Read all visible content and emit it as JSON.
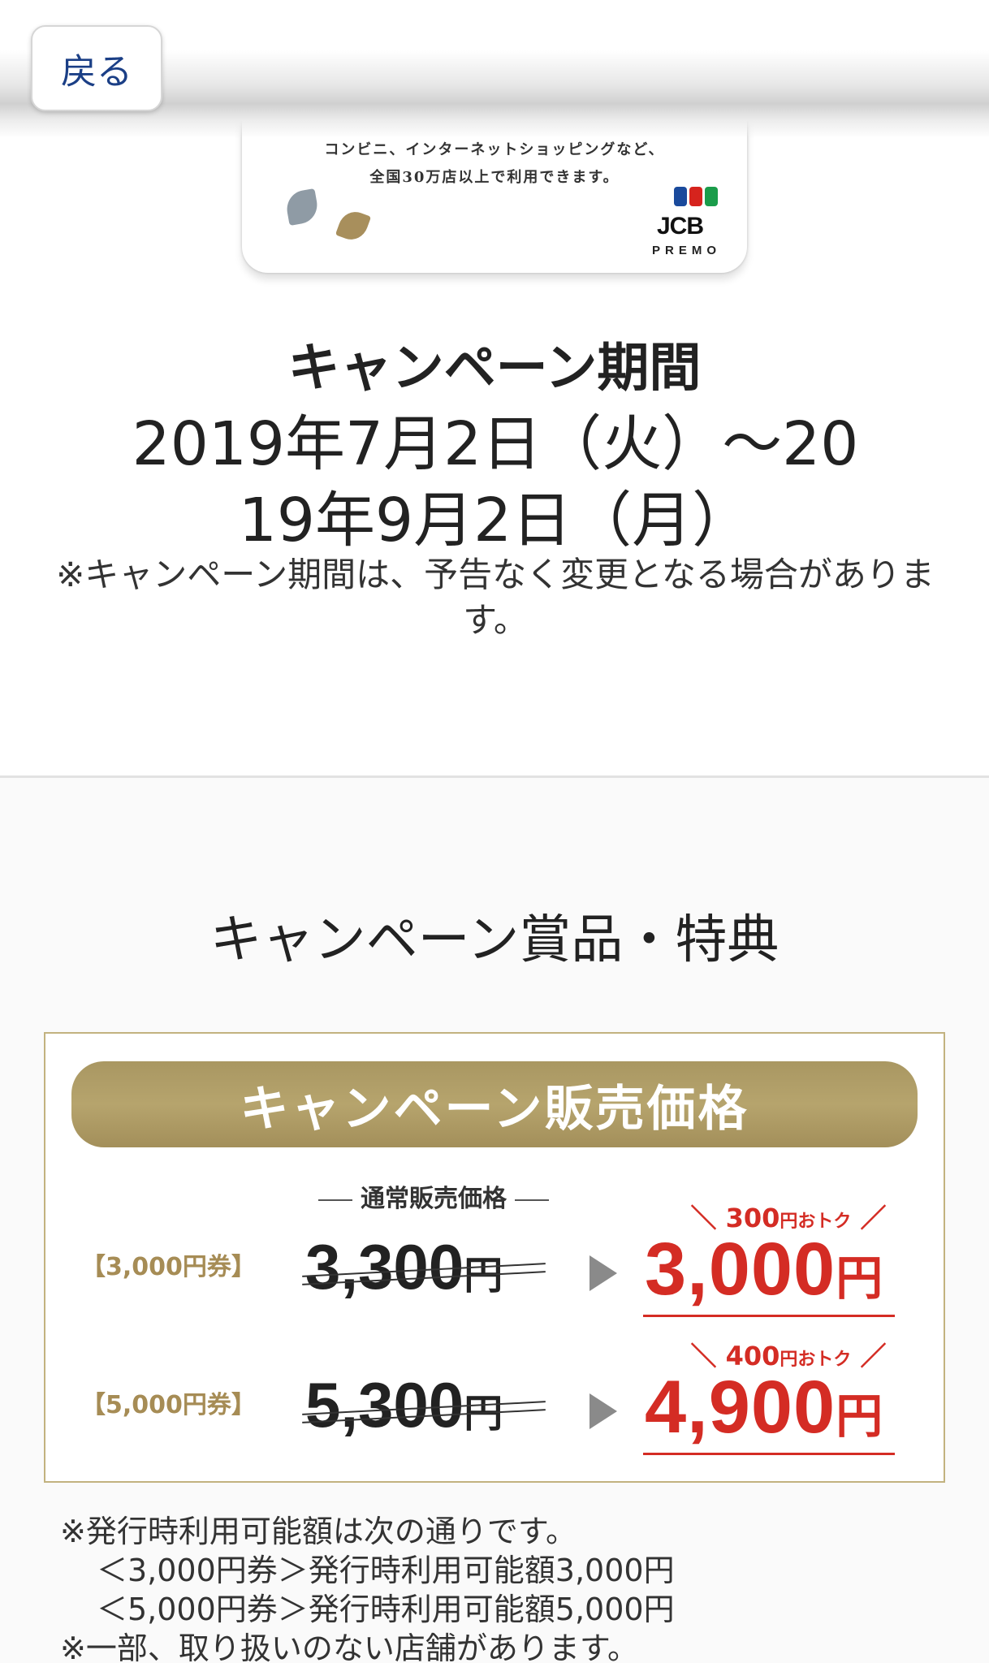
{
  "header": {
    "back_label": "戻る"
  },
  "card": {
    "line1": "コンビニ、インターネットショッピングなど、",
    "line2": "全国30万店以上で利用できます。",
    "logo_text": "JCB",
    "logo_sub": "PREMO",
    "logo_colors": [
      "#1a4a9c",
      "#d6231d",
      "#1a9c4a"
    ]
  },
  "period": {
    "title": "キャンペーン期間",
    "dates": "2019年7月2日（火）～2019年9月2日（月）",
    "note": "※キャンペーン期間は、予告なく変更となる場合があります。"
  },
  "prizes": {
    "title": "キャンペーン賞品・特典",
    "banner": "キャンペーン販売価格",
    "normal_price_label": "通常販売価格",
    "rows": [
      {
        "voucher": "【3,000円券】",
        "old_price": "3,300",
        "old_unit": "円",
        "save_amount": "300",
        "save_unit": "円おトク",
        "new_price": "3,000",
        "new_unit": "円"
      },
      {
        "voucher": "【5,000円券】",
        "old_price": "5,300",
        "old_unit": "円",
        "save_amount": "400",
        "save_unit": "円おトク",
        "new_price": "4,900",
        "new_unit": "円"
      }
    ]
  },
  "footnotes": {
    "line1": "※発行時利用可能額は次の通りです。",
    "line2": "＜3,000円券＞発行時利用可能額3,000円",
    "line3": "＜5,000円券＞発行時利用可能額5,000円",
    "line4": "※一部、取り扱いのない店舗があります。"
  },
  "colors": {
    "accent_red": "#d42c24",
    "gold": "#b09d66",
    "navy": "#1b3f86"
  }
}
